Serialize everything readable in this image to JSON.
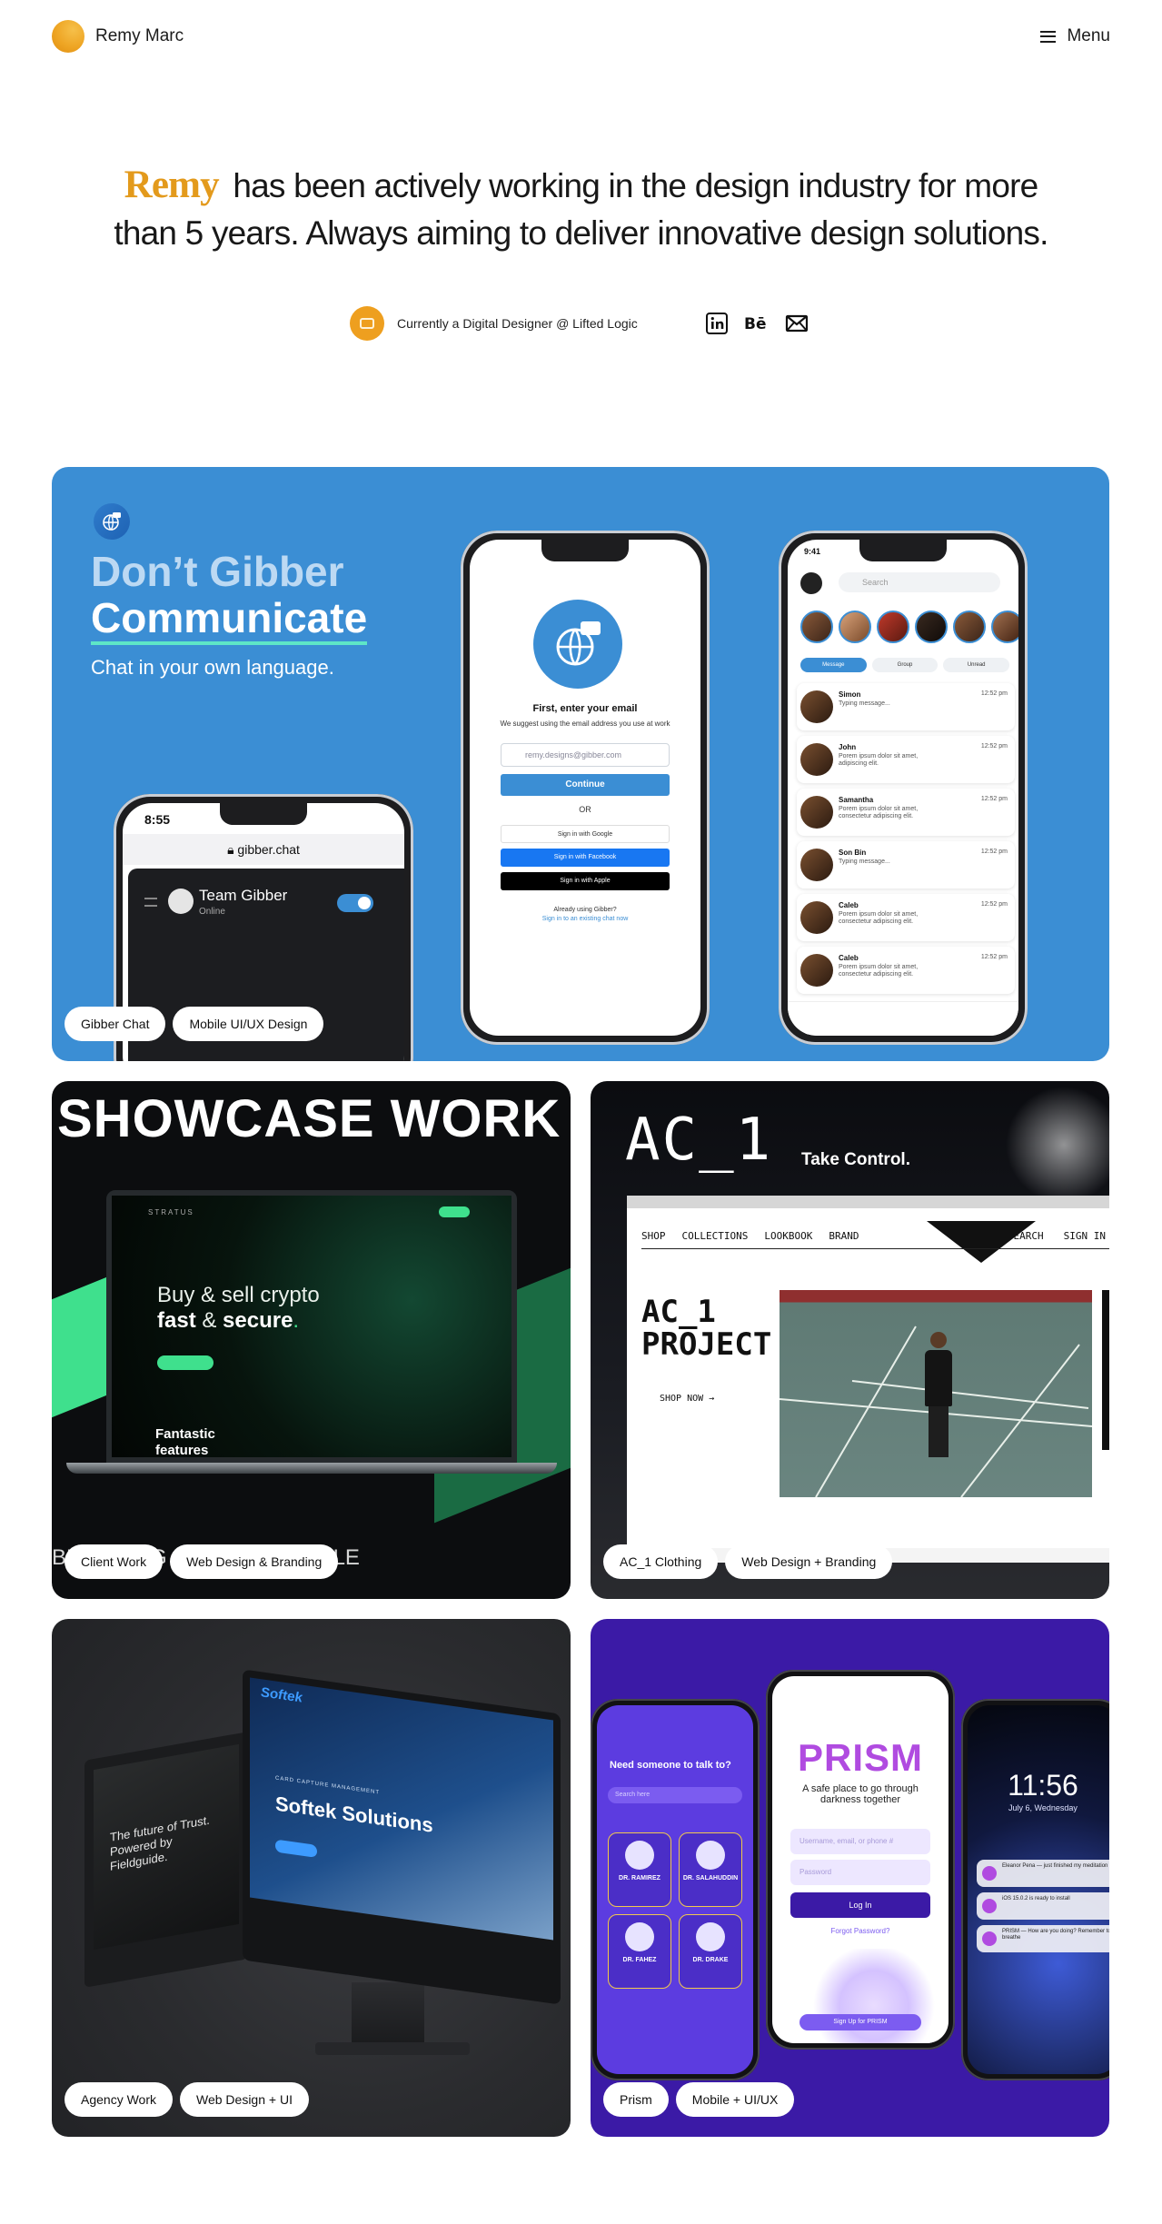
{
  "header": {
    "brand_name": "Remy Marc",
    "menu_label": "Menu"
  },
  "hero": {
    "highlight": "Remy",
    "line1_rest": "has been actively working in the design industry for more",
    "line2": "than 5 years. Always aiming to deliver innovative design solutions.",
    "status": "Currently a Digital Designer @ Lifted Logic",
    "socials": [
      "linkedin-icon",
      "behance-icon",
      "mail-icon"
    ]
  },
  "colors": {
    "accent": "#e39a1c",
    "gibber_bg": "#3b8ed4",
    "prism_bg": "#3b1aa6"
  },
  "projects": [
    {
      "tags": [
        "Gibber Chat",
        "Mobile UI/UX Design"
      ],
      "title_line1": "Don’t Gibber",
      "title_line2": "Communicate",
      "subtitle": "Chat in your own language.",
      "browser_time": "8:55",
      "browser_url": "gibber.chat",
      "team_name": "Team Gibber",
      "team_status": "Online",
      "login_title": "First, enter your email",
      "login_sub": "We suggest using the email address you use at work",
      "email_placeholder": "remy.designs@gibber.com",
      "continue": "Continue",
      "or": "OR",
      "sso_google": "Sign in with Google",
      "sso_facebook": "Sign in with Facebook",
      "sso_apple": "Sign in with Apple",
      "already": "Already using Gibber?",
      "existing_link": "Sign in to an existing chat now",
      "chat_time": "9:41",
      "search_placeholder": "Search",
      "chat_tabs": [
        "Message",
        "Group",
        "Unread"
      ],
      "chats": [
        {
          "name": "Simon",
          "msg": "Typing message...",
          "time": "12:52 pm"
        },
        {
          "name": "John",
          "msg": "Porem ipsum dolor sit amet, adipiscing elit.",
          "time": "12:52 pm"
        },
        {
          "name": "Samantha",
          "msg": "Porem ipsum dolor sit amet, consectetur adipiscing elit.",
          "time": "12:52 pm"
        },
        {
          "name": "Son Bin",
          "msg": "Typing message...",
          "time": "12:52 pm"
        },
        {
          "name": "Caleb",
          "msg": "Porem ipsum dolor sit amet, consectetur adipiscing elit.",
          "time": "12:52 pm"
        },
        {
          "name": "Caleb",
          "msg": "Porem ipsum dolor sit amet, consectetur adipiscing elit.",
          "time": "12:52 pm"
        }
      ]
    },
    {
      "tags": [
        "Client Work",
        "Web Design & Branding"
      ],
      "headline": "SHOWCASE WORK",
      "screen_brand": "STRATUS",
      "screen_heading_1": "Buy & sell crypto",
      "screen_heading_2": "fast",
      "screen_heading_amp": " & ",
      "screen_heading_3": "secure",
      "screen_heading_dot": ".",
      "screen_features": "Fantastic features",
      "bottom_nav": "BRANDING   ⊘ WEB   ⊘ MOBILE"
    },
    {
      "tags": [
        "AC_1 Clothing",
        "Web Design + Branding"
      ],
      "logo": "AC_1",
      "tagline": "Take Control.",
      "nav_left": [
        "SHOP",
        "COLLECTIONS",
        "LOOKBOOK",
        "BRAND"
      ],
      "nav_right": [
        "SEARCH",
        "SIGN IN"
      ],
      "project_title": "AC_1 PROJECT",
      "shop_now": "SHOP NOW →"
    },
    {
      "tags": [
        "Agency Work",
        "Web Design + UI"
      ],
      "left_screen_text": "The future of Trust. Powered by Fieldguide.",
      "softek_logo": "Softek",
      "softek_heading": "Softek Solutions",
      "softek_small": "CARD CAPTURE MANAGEMENT"
    },
    {
      "tags": [
        "Prism",
        "Mobile + UI/UX"
      ],
      "doc_heading": "Need someone to talk to?",
      "doc_search": "Search here",
      "doctors": [
        "DR. RAMIREZ",
        "DR. SALAHUDDIN",
        "DR. FAHEZ",
        "DR. DRAKE"
      ],
      "prism_logo": "PRISM",
      "prism_tagline": "A safe place to go through darkness together",
      "prism_user_placeholder": "Username, email, or phone #",
      "prism_pass_placeholder": "Password",
      "prism_login": "Log In",
      "prism_forgot": "Forgot Password?",
      "prism_signup": "Sign Up for PRISM",
      "lock_time": "11:56",
      "lock_date": "July 6, Wednesday",
      "notifications": [
        "Eleanor Pena — just finished my meditation",
        "iOS 15.0.2 is ready to install",
        "PRISM — How are you doing? Remember to breathe"
      ]
    }
  ]
}
